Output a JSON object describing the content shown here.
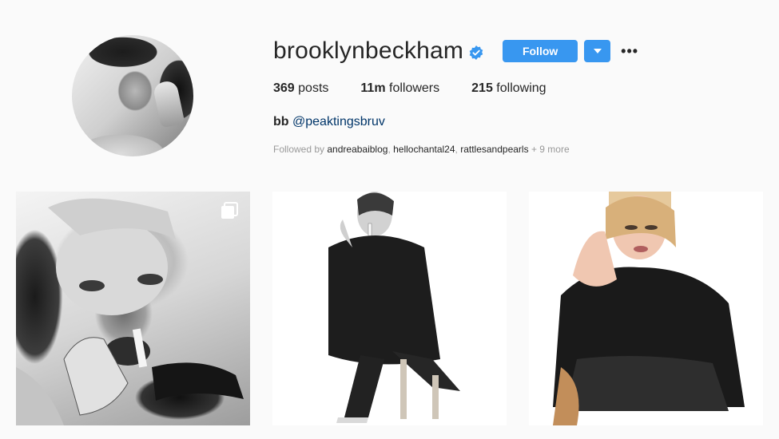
{
  "profile": {
    "username": "brooklynbeckham",
    "verified": true,
    "follow_label": "Follow",
    "more_label": "•••",
    "stats": {
      "posts_count": "369",
      "posts_label": "posts",
      "followers_count": "11m",
      "followers_label": "followers",
      "following_count": "215",
      "following_label": "following"
    },
    "bio": {
      "name": "bb",
      "handle": "@peaktingsbruv"
    },
    "followed_by": {
      "prefix": "Followed by",
      "users": [
        "andreabaiblog",
        "hellochantal24",
        "rattlesandpearls"
      ],
      "more": "+ 9 more"
    }
  },
  "colors": {
    "accent": "#3897f0",
    "background": "#fafafa",
    "text": "#262626",
    "muted": "#999999",
    "link": "#003569"
  },
  "icons": {
    "verified": "verified-badge-icon",
    "dropdown": "caret-down-icon",
    "more": "more-options-icon",
    "carousel": "carousel-icon"
  },
  "posts": [
    {
      "type": "photo",
      "carousel": true
    },
    {
      "type": "photo",
      "carousel": false
    },
    {
      "type": "photo",
      "carousel": false
    }
  ]
}
